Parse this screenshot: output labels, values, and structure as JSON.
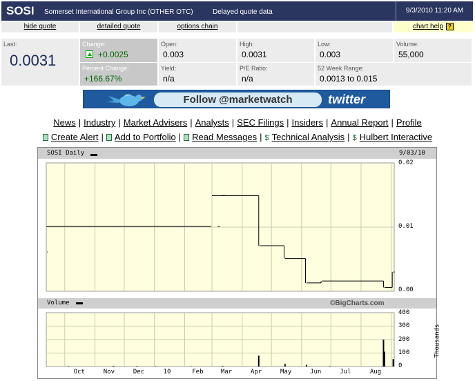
{
  "header": {
    "symbol": "SOSI",
    "company": "Somerset International Group Inc (OTHER OTC)",
    "quote_status": "Delayed quote data",
    "datetime": "9/3/2010 11:20 AM"
  },
  "links": {
    "hide_quote": "hide quote",
    "detailed_quote": "detailed quote",
    "options_chain": "options chain",
    "chart_help": "chart help",
    "help_glyph": "?"
  },
  "stats": {
    "last_label": "Last:",
    "last_value": "0.0031",
    "change_label": "Change:",
    "change_value": "+0.0025",
    "pct_change_label": "Percent Change:",
    "pct_change_value": "+166.67%",
    "open_label": "Open:",
    "open_value": "0.003",
    "high_label": "High:",
    "high_value": "0.0031",
    "low_label": "Low:",
    "low_value": "0.003",
    "volume_label": "Volume:",
    "volume_value": "55,000",
    "yield_label": "Yield:",
    "yield_value": "n/a",
    "pe_label": "P/E Ratio:",
    "pe_value": "n/a",
    "week52_label": "52 Week Range:",
    "week52_low": "0.0013",
    "week52_to": "to",
    "week52_high": "0.015"
  },
  "banner": {
    "text": "Follow @marketwatch",
    "brand": "twitter"
  },
  "nav": {
    "row1": [
      "News",
      "Industry",
      "Market Advisers",
      "Analysts",
      "SEC Filings",
      "Insiders",
      "Annual Report",
      "Profile"
    ],
    "row1_sep": "|",
    "create_alert": "Create Alert",
    "add_portfolio": "Add to Portfolio",
    "read_messages": "Read Messages",
    "technical_analysis": "Technical Analysis",
    "hulbert": "Hulbert Interactive",
    "dollar": "$"
  },
  "chart": {
    "title": "SOSI Daily",
    "date": "9/03/10",
    "volume_label": "Volume",
    "watermark": "©BigCharts.com",
    "volume_unit": "Thousands",
    "price_ticks": [
      "0.02",
      "0.01",
      "0.00"
    ],
    "volume_ticks": [
      "400",
      "300",
      "200",
      "100",
      "0"
    ],
    "x_labels": [
      "Oct",
      "Nov",
      "Dec",
      "10",
      "Feb",
      "Mar",
      "Apr",
      "May",
      "Jun",
      "Jul",
      "Aug"
    ]
  },
  "chart_data": {
    "type": "line",
    "price": {
      "ylim": [
        0,
        0.02
      ],
      "segments": [
        {
          "from": "2009-09-12",
          "to": "2010-02-28",
          "value": 0.0101
        },
        {
          "from": "2010-03-01",
          "to": "2010-03-15",
          "value": 0.0149
        },
        {
          "from": "2010-03-07",
          "to": "2010-03-09",
          "value": 0.0101
        },
        {
          "from": "2010-03-11",
          "to": "2010-04-18",
          "value": 0.0149
        },
        {
          "from": "2010-04-19",
          "to": "2010-05-14",
          "value": 0.0071
        },
        {
          "from": "2010-05-15",
          "to": "2010-06-05",
          "value": 0.0051
        },
        {
          "from": "2010-06-06",
          "to": "2010-06-21",
          "value": 0.0013
        },
        {
          "from": "2010-06-22",
          "to": "2010-08-24",
          "value": 0.0016
        },
        {
          "from": "2010-08-25",
          "to": "2010-09-02",
          "value": 0.0006
        },
        {
          "from": "2010-09-03",
          "to": "2010-09-03",
          "value": 0.003
        }
      ]
    },
    "volume": {
      "ylim": [
        0,
        400
      ],
      "bars": [
        {
          "date": "2009-10-05",
          "value": 3
        },
        {
          "date": "2009-11-20",
          "value": 5
        },
        {
          "date": "2009-12-14",
          "value": 4
        },
        {
          "date": "2010-01-02",
          "value": 3
        },
        {
          "date": "2010-02-08",
          "value": 2
        },
        {
          "date": "2010-03-12",
          "value": 5
        },
        {
          "date": "2010-04-18",
          "value": 80
        },
        {
          "date": "2010-05-15",
          "value": 18
        },
        {
          "date": "2010-06-06",
          "value": 12
        },
        {
          "date": "2010-06-30",
          "value": 3
        },
        {
          "date": "2010-08-24",
          "value": 200
        },
        {
          "date": "2010-08-25",
          "value": 110
        },
        {
          "date": "2010-09-03",
          "value": 55
        }
      ]
    }
  }
}
